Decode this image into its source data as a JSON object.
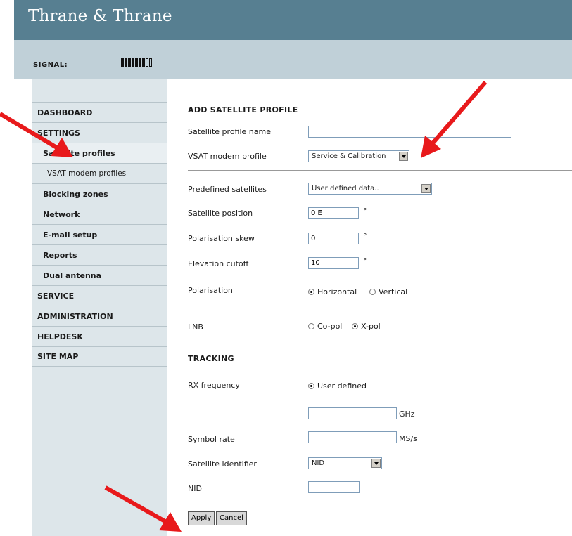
{
  "header": {
    "logo": "Thrane & Thrane"
  },
  "signal": {
    "label": "SIGNAL:",
    "filled_segments": 7,
    "total_segments": 9
  },
  "sidebar": {
    "items": [
      {
        "label": "DASHBOARD"
      },
      {
        "label": "SETTINGS"
      },
      {
        "label": "Satellite profiles"
      },
      {
        "label": "VSAT modem profiles"
      },
      {
        "label": "Blocking zones"
      },
      {
        "label": "Network"
      },
      {
        "label": "E-mail setup"
      },
      {
        "label": "Reports"
      },
      {
        "label": "Dual antenna"
      },
      {
        "label": "SERVICE"
      },
      {
        "label": "ADMINISTRATION"
      },
      {
        "label": "HELPDESK"
      },
      {
        "label": "SITE MAP"
      }
    ]
  },
  "form": {
    "title": "ADD SATELLITE PROFILE",
    "profile_name": {
      "label": "Satellite profile name",
      "value": ""
    },
    "modem_profile": {
      "label": "VSAT modem profile",
      "value": "Service & Calibration"
    },
    "predefined": {
      "label": "Predefined satellites",
      "value": "User defined data.."
    },
    "position": {
      "label": "Satellite position",
      "value": "0 E",
      "unit": "°"
    },
    "skew": {
      "label": "Polarisation skew",
      "value": "0",
      "unit": "°"
    },
    "elevation": {
      "label": "Elevation cutoff",
      "value": "10",
      "unit": "°"
    },
    "polarisation": {
      "label": "Polarisation",
      "option1": "Horizontal",
      "option2": "Vertical",
      "selected": "Horizontal"
    },
    "lnb": {
      "label": "LNB",
      "option1": "Co-pol",
      "option2": "X-pol",
      "selected": "X-pol"
    },
    "tracking_title": "TRACKING",
    "rx": {
      "label": "RX frequency",
      "option": "User defined",
      "value": "",
      "unit": "GHz"
    },
    "symbol_rate": {
      "label": "Symbol rate",
      "value": "",
      "unit": "MS/s"
    },
    "identifier": {
      "label": "Satellite identifier",
      "value": "NID"
    },
    "nid": {
      "label": "NID",
      "value": ""
    },
    "apply": "Apply",
    "cancel": "Cancel"
  },
  "colors": {
    "header": "#577f91",
    "signal_bar": "#c0d0d8",
    "sidebar": "#dde6ea",
    "arrow": "#e8191b"
  }
}
